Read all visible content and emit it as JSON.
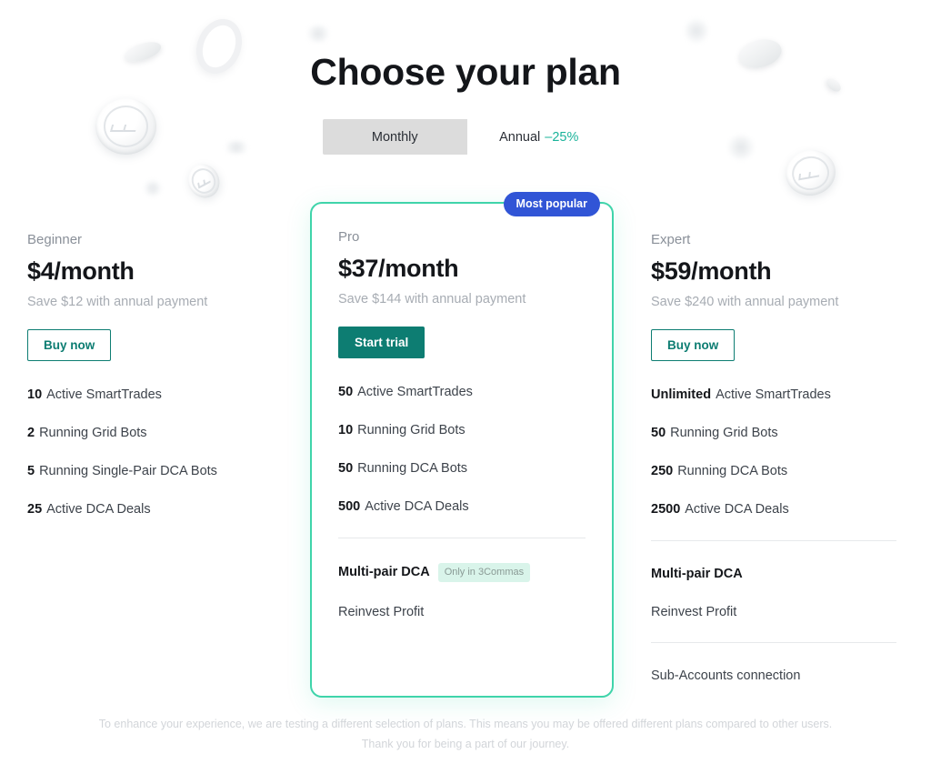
{
  "page": {
    "title": "Choose your plan",
    "footer_line1": "To enhance your experience, we are testing a different selection of plans. This means you may be offered different plans compared to other users.",
    "footer_line2": "Thank you for being a part of our journey."
  },
  "billing_toggle": {
    "monthly_label": "Monthly",
    "annual_label": "Annual",
    "annual_discount": "–25%",
    "selected": "Monthly"
  },
  "colors": {
    "accent_teal": "#0d7d72",
    "card_border_mint": "#3fd4aa",
    "badge_blue": "#3155d6",
    "discount_green": "#1ab39a",
    "tag_bg_mint": "#d9f4ea",
    "toggle_active_gray": "#dcdcdc"
  },
  "plans": [
    {
      "name": "Beginner",
      "price": "$4/month",
      "save_text": "Save $12 with annual payment",
      "cta_label": "Buy now",
      "cta_style": "outline",
      "featured": false,
      "badge": null,
      "groups": [
        {
          "features": [
            {
              "qty": "10",
              "text": "Active SmartTrades",
              "tag": null
            },
            {
              "qty": "2",
              "text": "Running Grid Bots",
              "tag": null
            },
            {
              "qty": "5",
              "text": "Running Single-Pair DCA Bots",
              "tag": null
            },
            {
              "qty": "25",
              "text": "Active DCA Deals",
              "tag": null
            }
          ]
        }
      ]
    },
    {
      "name": "Pro",
      "price": "$37/month",
      "save_text": "Save $144 with annual payment",
      "cta_label": "Start trial",
      "cta_style": "solid",
      "featured": true,
      "badge": "Most popular",
      "groups": [
        {
          "features": [
            {
              "qty": "50",
              "text": "Active SmartTrades",
              "tag": null
            },
            {
              "qty": "10",
              "text": "Running Grid Bots",
              "tag": null
            },
            {
              "qty": "50",
              "text": "Running DCA Bots",
              "tag": null
            },
            {
              "qty": "500",
              "text": "Active DCA Deals",
              "tag": null
            }
          ]
        },
        {
          "features": [
            {
              "qty": "Multi-pair DCA",
              "text": "",
              "tag": "Only in 3Commas"
            },
            {
              "qty": "",
              "text": "Reinvest Profit",
              "tag": null
            }
          ]
        }
      ]
    },
    {
      "name": "Expert",
      "price": "$59/month",
      "save_text": "Save $240 with annual payment",
      "cta_label": "Buy now",
      "cta_style": "outline",
      "featured": false,
      "badge": null,
      "groups": [
        {
          "features": [
            {
              "qty": "Unlimited",
              "text": "Active SmartTrades",
              "tag": null
            },
            {
              "qty": "50",
              "text": "Running Grid Bots",
              "tag": null
            },
            {
              "qty": "250",
              "text": "Running DCA Bots",
              "tag": null
            },
            {
              "qty": "2500",
              "text": "Active DCA Deals",
              "tag": null
            }
          ]
        },
        {
          "features": [
            {
              "qty": "Multi-pair DCA",
              "text": "",
              "tag": null
            },
            {
              "qty": "",
              "text": "Reinvest Profit",
              "tag": null
            }
          ]
        },
        {
          "features": [
            {
              "qty": "",
              "text": "Sub-Accounts connection",
              "tag": null
            }
          ]
        }
      ]
    }
  ]
}
